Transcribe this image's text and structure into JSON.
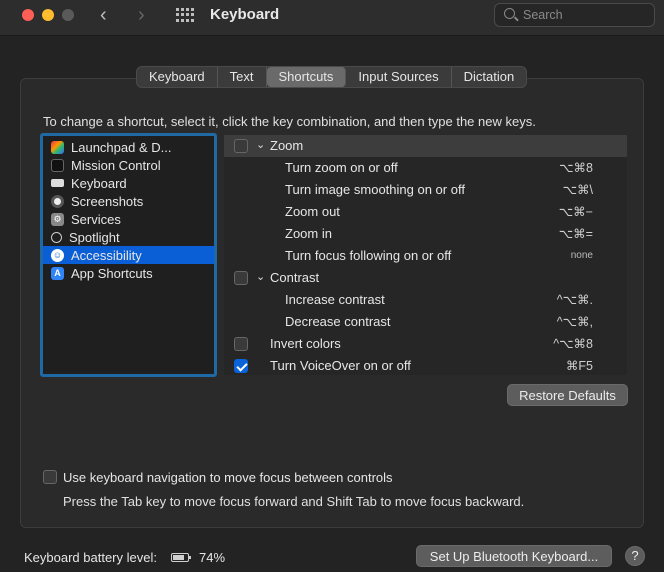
{
  "window": {
    "title": "Keyboard"
  },
  "search": {
    "placeholder": "Search"
  },
  "tabs": [
    {
      "label": "Keyboard",
      "active": false
    },
    {
      "label": "Text",
      "active": false
    },
    {
      "label": "Shortcuts",
      "active": true
    },
    {
      "label": "Input Sources",
      "active": false
    },
    {
      "label": "Dictation",
      "active": false
    }
  ],
  "instructions": "To change a shortcut, select it, click the key combination, and then type the new keys.",
  "categories": [
    {
      "label": "Launchpad & D...",
      "icon": "launchpad-icon"
    },
    {
      "label": "Mission Control",
      "icon": "mission-control-icon"
    },
    {
      "label": "Keyboard",
      "icon": "keyboard-icon"
    },
    {
      "label": "Screenshots",
      "icon": "screenshot-icon"
    },
    {
      "label": "Services",
      "icon": "services-icon"
    },
    {
      "label": "Spotlight",
      "icon": "spotlight-icon"
    },
    {
      "label": "Accessibility",
      "icon": "accessibility-icon",
      "selected": true
    },
    {
      "label": "App Shortcuts",
      "icon": "app-shortcuts-icon"
    }
  ],
  "shortcuts": [
    {
      "label": "Zoom",
      "group": true,
      "checked": false,
      "keys": ""
    },
    {
      "label": "Turn zoom on or off",
      "keys": "⌥⌘8"
    },
    {
      "label": "Turn image smoothing on or off",
      "keys": "⌥⌘\\"
    },
    {
      "label": "Zoom out",
      "keys": "⌥⌘−"
    },
    {
      "label": "Zoom in",
      "keys": "⌥⌘="
    },
    {
      "label": "Turn focus following on or off",
      "keys": "none"
    },
    {
      "label": "Contrast",
      "group": true,
      "checked": false,
      "keys": ""
    },
    {
      "label": "Increase contrast",
      "keys": "^⌥⌘."
    },
    {
      "label": "Decrease contrast",
      "keys": "^⌥⌘,"
    },
    {
      "label": "Invert colors",
      "checked": false,
      "keys": "^⌥⌘8"
    },
    {
      "label": "Turn VoiceOver on or off",
      "checked": true,
      "keys": "⌘F5"
    }
  ],
  "buttons": {
    "restore_defaults": "Restore Defaults",
    "setup_bluetooth": "Set Up Bluetooth Keyboard...",
    "help": "?"
  },
  "keyboard_nav": {
    "label": "Use keyboard navigation to move focus between controls",
    "hint": "Press the Tab key to move focus forward and Shift Tab to move focus backward.",
    "checked": false
  },
  "battery": {
    "label": "Keyboard battery level:",
    "percent": "74%",
    "level": 0.74
  },
  "colors": {
    "accent": "#0a5fd6",
    "focus_ring": "#1f6aa5",
    "background": "#232323"
  }
}
